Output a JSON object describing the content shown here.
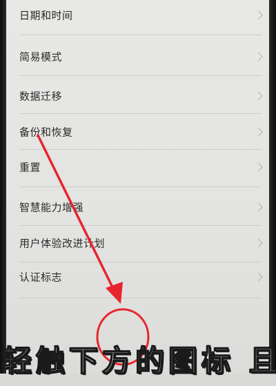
{
  "settings": {
    "items": [
      {
        "label": "日期和时间",
        "icon": "chevron-right-icon"
      },
      {
        "label": "简易模式",
        "icon": "chevron-right-icon"
      },
      {
        "label": "数据迁移",
        "icon": "chevron-right-icon"
      },
      {
        "label": "备份和恢复",
        "icon": "chevron-right-icon"
      },
      {
        "label": "重置",
        "icon": "chevron-right-icon"
      },
      {
        "label": "智慧能力增强",
        "icon": "chevron-right-icon"
      },
      {
        "label": "用户体验改进计划",
        "icon": "chevron-right-icon"
      },
      {
        "label": "认证标志",
        "icon": "chevron-right-icon"
      }
    ]
  },
  "annotation": {
    "caption": "轻触下方的图标 且",
    "arrow_color": "#e8242c",
    "circle_color": "#e8242c"
  }
}
